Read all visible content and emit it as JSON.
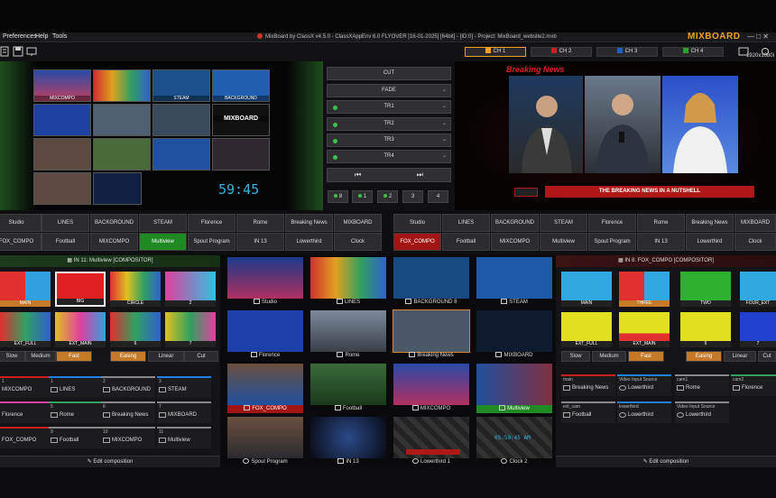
{
  "window": {
    "title": "MixBoard by ClassX v4.5.0 - ClassXAppEnv 6.0 FLYOVER [16-01-2025] [64bit] - [ID:0] - Project: MixBoard_website2.mxb",
    "controls": "— □ ✕"
  },
  "menu": [
    "Preferences",
    "Help",
    "Tools"
  ],
  "toolbar": {
    "channels": [
      {
        "label": "CH 1",
        "color": "#f0a020",
        "active": true
      },
      {
        "label": "CH 2",
        "color": "#c82020"
      },
      {
        "label": "CH 3",
        "color": "#2060c8"
      },
      {
        "label": "CH 4",
        "color": "#30a030"
      }
    ],
    "logo": "MIXBOARD",
    "resolution": "1920x1080i"
  },
  "preview": {
    "tiles": [
      "MIXCOMPO",
      "",
      "STEAM",
      "BACKGROUND",
      "",
      "",
      "",
      "MIXBOARD",
      "",
      "",
      "",
      "",
      "",
      "",
      "",
      ""
    ],
    "clock": "59:45"
  },
  "transitions": {
    "cut": "CUT",
    "fade": "FADE",
    "items": [
      "TR1",
      "TR2",
      "TR3",
      "TR4"
    ],
    "numbers": [
      "8",
      "1",
      "2",
      "3",
      "4"
    ]
  },
  "program": {
    "banner": "Breaking News",
    "lowerthird": "THE BREAKING NEWS IN A NUTSHELL"
  },
  "sources": {
    "row1": [
      "Studio",
      "LINES",
      "BACKGROUND",
      "STEAM",
      "Florence",
      "Rome",
      "Breaking News",
      "MIXBOARD"
    ],
    "row2": [
      "FOX_COMPO",
      "Football",
      "MIXCOMPO",
      "Multiview",
      "Spout Program",
      "IN 13",
      "Lowerthird",
      "Clock"
    ],
    "row2_green_index": 3,
    "row2b_red_index": 0
  },
  "left_compositor": {
    "header": "IN 11: Multiview [COMPOSITOR]",
    "layouts": [
      "MAIN",
      "BIG",
      "CIRCLE",
      "2",
      "EXT_FULL",
      "EXT_MAIN",
      "6",
      "7"
    ],
    "easing_buttons": [
      "Slow",
      "Medium",
      "Fast",
      "Easing",
      "Linear",
      "Cut"
    ],
    "slots": [
      {
        "num": "1",
        "label": "MIXCOMPO"
      },
      {
        "num": "1",
        "label": "LINES"
      },
      {
        "num": "2",
        "label": "BACKGROUND"
      },
      {
        "num": "3",
        "label": "STEAM"
      },
      {
        "num": "",
        "label": "Florence"
      },
      {
        "num": "5",
        "label": "Rome"
      },
      {
        "num": "6",
        "label": "Breaking News"
      },
      {
        "num": "7",
        "label": "MIXBOARD"
      },
      {
        "num": "",
        "label": "FOX_COMPO"
      },
      {
        "num": "9",
        "label": "Football"
      },
      {
        "num": "10",
        "label": "MIXCOMPO"
      },
      {
        "num": "11",
        "label": "Multiview"
      }
    ],
    "edit": "Edit composition"
  },
  "media": [
    {
      "label": "Studio",
      "num": ""
    },
    {
      "label": "LINES",
      "num": ""
    },
    {
      "label": "BACKGROUND",
      "num": "8"
    },
    {
      "label": "STEAM",
      "num": ""
    },
    {
      "label": "Florence",
      "num": ""
    },
    {
      "label": "Rome",
      "num": ""
    },
    {
      "label": "Breaking News",
      "num": ""
    },
    {
      "label": "MIXBOARD",
      "num": ""
    },
    {
      "label": "FOX_COMPO",
      "num": ""
    },
    {
      "label": "Football",
      "num": ""
    },
    {
      "label": "MIXCOMPO",
      "num": ""
    },
    {
      "label": "Multiview",
      "num": ""
    },
    {
      "label": "Spout Program",
      "num": ""
    },
    {
      "label": "IN 13",
      "num": ""
    },
    {
      "label": "Lowerthird",
      "num": "1"
    },
    {
      "label": "Clock",
      "num": "2"
    }
  ],
  "media_clock": "05:59:45 AM",
  "right_compositor": {
    "header": "IN 8: FOX_COMPO [COMPOSITOR]",
    "layouts": [
      "MAIN",
      "THREE",
      "TWO",
      "FOUR_EXT",
      "EXT_FULL",
      "EXT_MAIN",
      "6",
      "7"
    ],
    "easing_buttons": [
      "Slow",
      "Medium",
      "Fast",
      "Easing",
      "Linear",
      "Cut"
    ],
    "slots": [
      {
        "num": "main",
        "label": "Breaking News"
      },
      {
        "num": "Video Input Source",
        "label": "Lowerthird"
      },
      {
        "num": "cam1",
        "label": "Rome"
      },
      {
        "num": "cam2",
        "label": "Florence"
      },
      {
        "num": "ext_cam",
        "label": "Football"
      },
      {
        "num": "lowerthird",
        "label": "Lowerthird"
      },
      {
        "num": "Video Input Source",
        "label": "Lowerthird"
      }
    ],
    "edit": "Edit composition"
  }
}
